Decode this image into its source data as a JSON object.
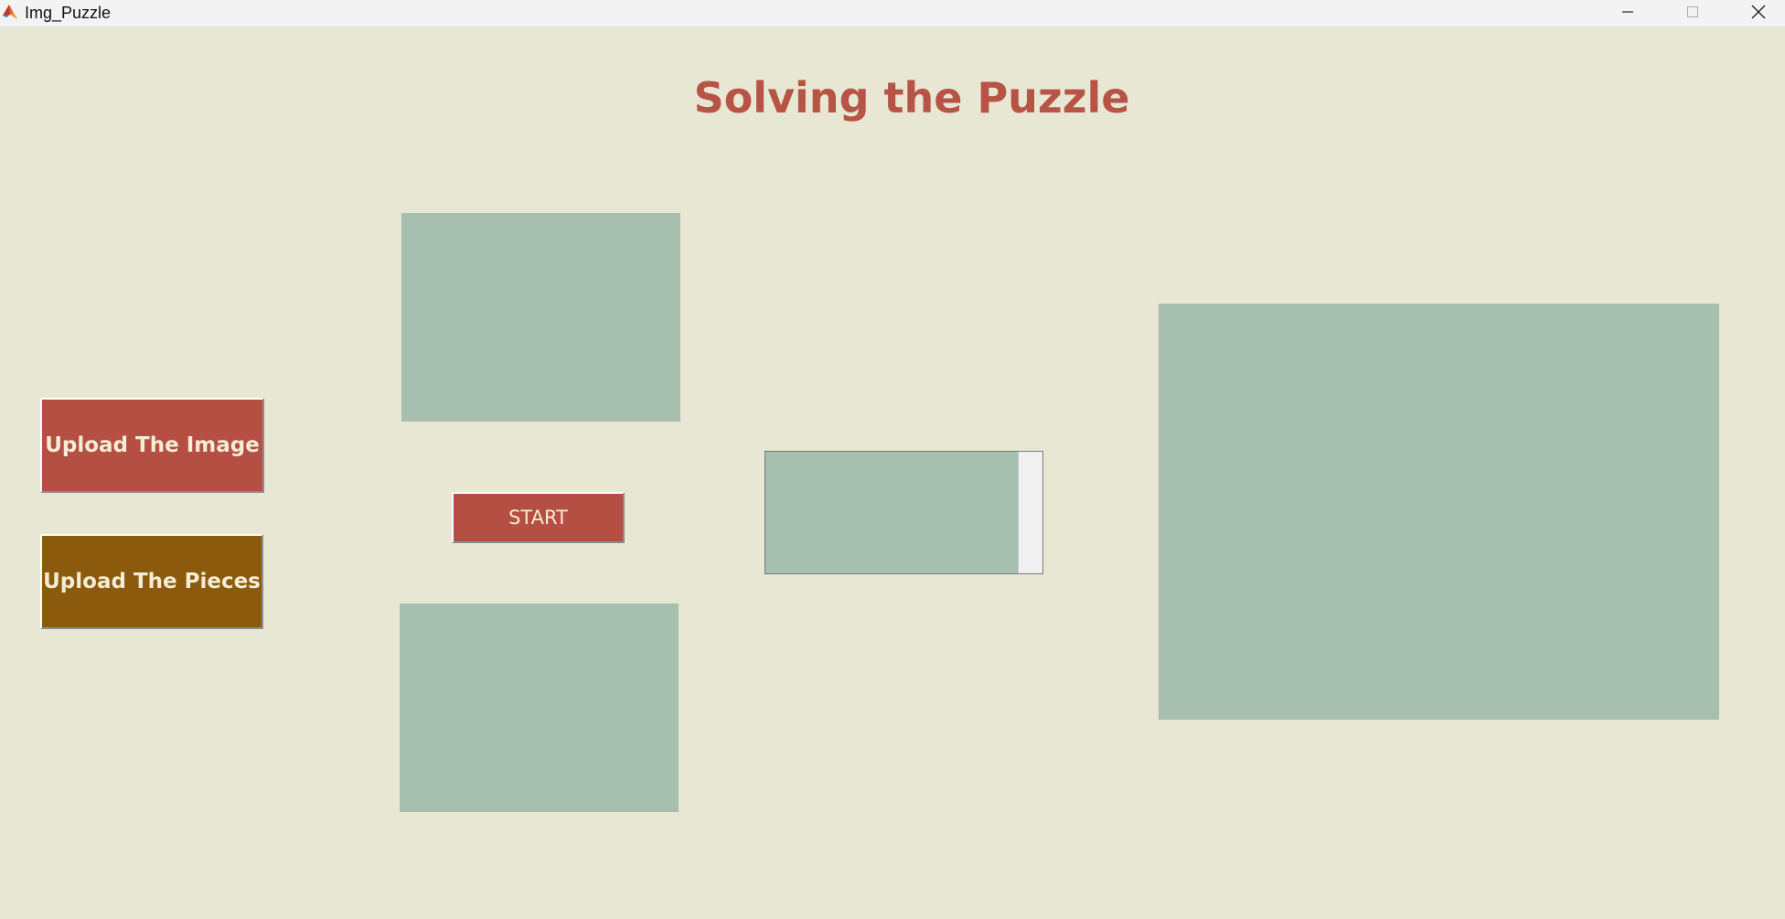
{
  "window": {
    "title": "Img_Puzzle"
  },
  "header": {
    "title": "Solving the Puzzle"
  },
  "buttons": {
    "upload_image": "Upload The Image",
    "upload_pieces": "Upload The Pieces",
    "start": "START"
  },
  "icons": {
    "app": "matlab-icon",
    "minimize": "minimize-icon",
    "maximize": "maximize-icon",
    "close": "close-icon"
  },
  "colors": {
    "background": "#e7e7d3",
    "panel": "#a7bfae",
    "title": "#b85445",
    "upload_image_button": "#b54e43",
    "upload_pieces_button": "#8b5a0d",
    "start_button": "#b54e43",
    "button_text": "#f4ecd4"
  }
}
